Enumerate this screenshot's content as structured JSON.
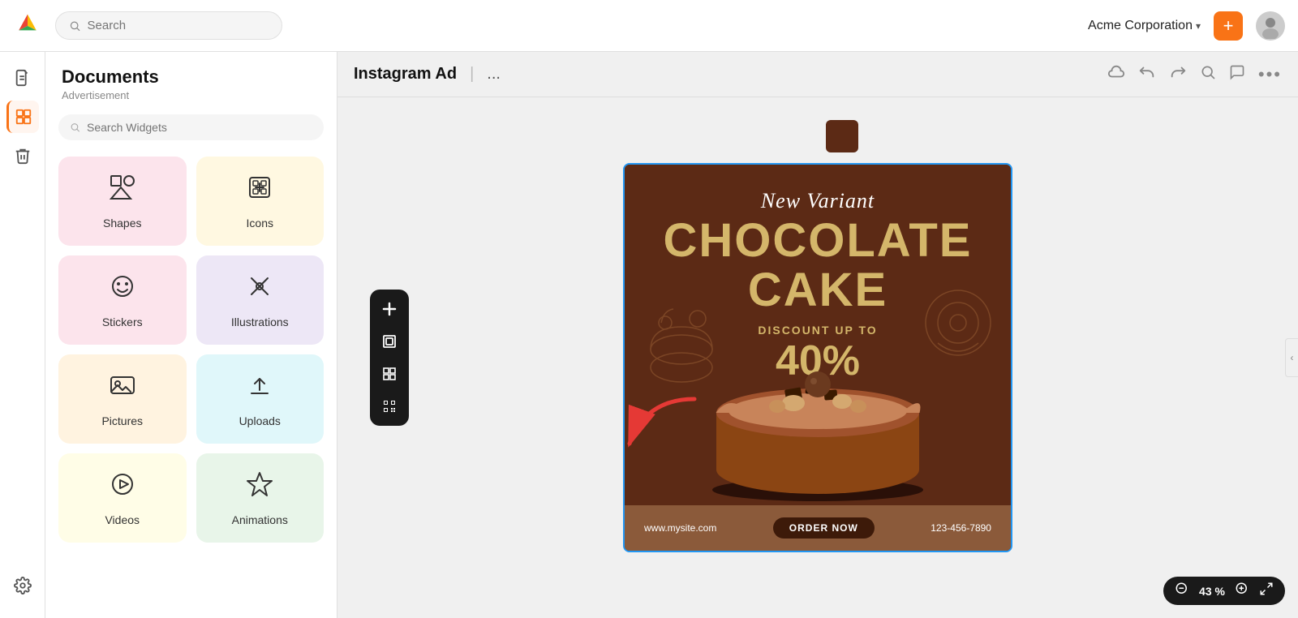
{
  "app": {
    "logo_colors": [
      "#ea4335",
      "#fbbc05",
      "#34a853",
      "#4285f4"
    ]
  },
  "topbar": {
    "search_placeholder": "Search",
    "company_name": "Acme Corporation",
    "add_button_label": "+",
    "chevron": "▾"
  },
  "icon_bar": {
    "items": [
      {
        "name": "document-icon",
        "icon": "📄",
        "active": false
      },
      {
        "name": "template-icon",
        "icon": "📋",
        "active": true
      },
      {
        "name": "trash-icon",
        "icon": "🗑",
        "active": false
      }
    ],
    "settings_icon": "⚙"
  },
  "sidebar": {
    "title": "Documents",
    "subtitle": "Advertisement",
    "search_placeholder": "Search Widgets",
    "widgets": [
      {
        "id": "shapes",
        "label": "Shapes",
        "color": "pink",
        "icon": "shapes"
      },
      {
        "id": "icons",
        "label": "Icons",
        "color": "yellow",
        "icon": "icons"
      },
      {
        "id": "stickers",
        "label": "Stickers",
        "color": "light-pink",
        "icon": "stickers"
      },
      {
        "id": "illustrations",
        "label": "Illustrations",
        "color": "lavender",
        "icon": "illustrations"
      },
      {
        "id": "pictures",
        "label": "Pictures",
        "color": "light-orange",
        "icon": "pictures"
      },
      {
        "id": "uploads",
        "label": "Uploads",
        "color": "teal",
        "icon": "uploads"
      },
      {
        "id": "videos",
        "label": "Videos",
        "color": "light-yellow",
        "icon": "videos"
      },
      {
        "id": "animations",
        "label": "Animations",
        "color": "light-green",
        "icon": "animations"
      }
    ]
  },
  "canvas": {
    "title": "Instagram Ad",
    "separator": "|",
    "more": "...",
    "icons": {
      "cloud": "☁",
      "undo": "↩",
      "redo": "↪",
      "search": "🔍",
      "comment": "💬",
      "more": "⋯"
    }
  },
  "vertical_toolbar": {
    "buttons": [
      {
        "name": "add-btn",
        "icon": "+"
      },
      {
        "name": "resize-btn",
        "icon": "⊡"
      },
      {
        "name": "grid-btn",
        "icon": "⊞"
      },
      {
        "name": "qr-btn",
        "icon": "⠿"
      }
    ]
  },
  "ad": {
    "script_text": "New Variant",
    "title_line1": "CHOCOLATE",
    "title_line2": "CAKE",
    "discount_label": "DISCOUNT UP TO",
    "discount_pct": "40%",
    "website": "www.mysite.com",
    "order_btn": "ORDER NOW",
    "phone": "123-456-7890",
    "bg_color": "#5c2a15",
    "accent_color": "#d4b66a"
  },
  "zoom": {
    "pct": "43 %",
    "minus": "⊖",
    "plus": "⊕",
    "expand": "⛶"
  },
  "selected_color": "#5c2a15"
}
